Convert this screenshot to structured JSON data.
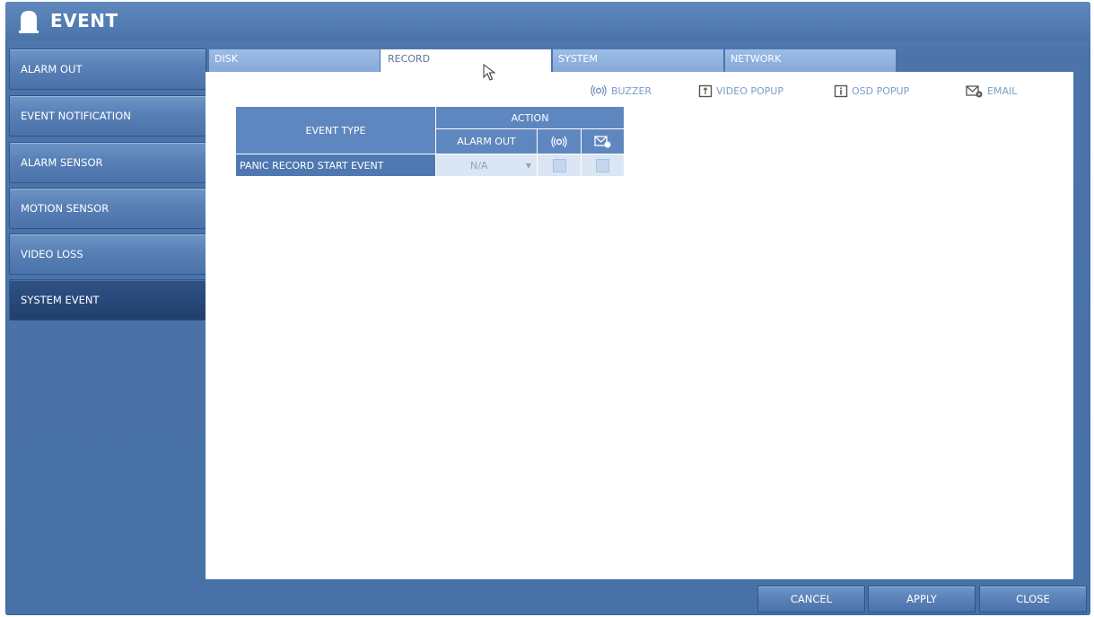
{
  "window": {
    "title": "EVENT"
  },
  "sidebar": {
    "items": [
      {
        "label": "ALARM OUT",
        "active": false
      },
      {
        "label": "EVENT NOTIFICATION",
        "active": false
      },
      {
        "label": "ALARM SENSOR",
        "active": false
      },
      {
        "label": "MOTION SENSOR",
        "active": false
      },
      {
        "label": "VIDEO LOSS",
        "active": false
      },
      {
        "label": "SYSTEM EVENT",
        "active": true
      }
    ]
  },
  "tabs": [
    {
      "label": "DISK",
      "active": false
    },
    {
      "label": "RECORD",
      "active": true
    },
    {
      "label": "SYSTEM",
      "active": false
    },
    {
      "label": "NETWORK",
      "active": false
    }
  ],
  "legend": {
    "buzzer": "BUZZER",
    "video_popup": "VIDEO POPUP",
    "osd_popup": "OSD POPUP",
    "email": "EMAIL"
  },
  "table": {
    "event_type_header": "EVENT TYPE",
    "action_header": "ACTION",
    "alarm_out_header": "ALARM OUT",
    "rows": [
      {
        "event": "PANIC RECORD START EVENT",
        "alarm_out": "N/A",
        "buzzer": false,
        "email": false
      }
    ]
  },
  "buttons": {
    "cancel": "CANCEL",
    "apply": "APPLY",
    "close": "CLOSE"
  },
  "colors": {
    "frame": "#4c74aa",
    "active_sidebar": "#2a4a7c",
    "tab": "#8db0de",
    "header_cell": "#5f87bf"
  }
}
